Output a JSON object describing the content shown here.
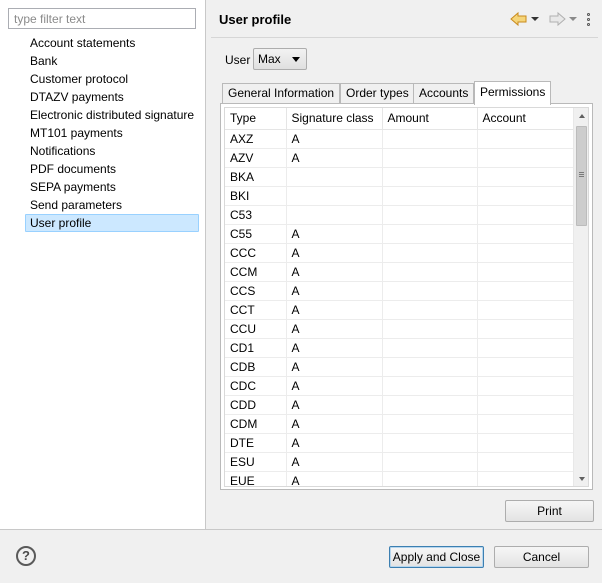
{
  "sidebar": {
    "filter_placeholder": "type filter text",
    "items": [
      {
        "label": "Account statements"
      },
      {
        "label": "Bank"
      },
      {
        "label": "Customer protocol"
      },
      {
        "label": "DTAZV payments"
      },
      {
        "label": "Electronic distributed signature"
      },
      {
        "label": "MT101 payments"
      },
      {
        "label": "Notifications"
      },
      {
        "label": "PDF documents"
      },
      {
        "label": "SEPA payments"
      },
      {
        "label": "Send parameters"
      },
      {
        "label": "User profile",
        "selected": true
      }
    ]
  },
  "header": {
    "title": "User profile",
    "back_icon": "back-arrow-icon",
    "forward_icon": "forward-arrow-icon",
    "menu_icon": "view-menu-icon"
  },
  "user": {
    "label": "User",
    "selected": "Max"
  },
  "tabs": [
    {
      "label": "General Information"
    },
    {
      "label": "Order types"
    },
    {
      "label": "Accounts"
    },
    {
      "label": "Permissions",
      "active": true
    }
  ],
  "table": {
    "columns": [
      "Type",
      "Signature class",
      "Amount",
      "Account"
    ],
    "rows": [
      {
        "type": "AXZ",
        "sig": "A",
        "amount": "",
        "account": ""
      },
      {
        "type": "AZV",
        "sig": "A",
        "amount": "",
        "account": ""
      },
      {
        "type": "BKA",
        "sig": "",
        "amount": "",
        "account": ""
      },
      {
        "type": "BKI",
        "sig": "",
        "amount": "",
        "account": ""
      },
      {
        "type": "C53",
        "sig": "",
        "amount": "",
        "account": ""
      },
      {
        "type": "C55",
        "sig": "A",
        "amount": "",
        "account": ""
      },
      {
        "type": "CCC",
        "sig": "A",
        "amount": "",
        "account": ""
      },
      {
        "type": "CCM",
        "sig": "A",
        "amount": "",
        "account": ""
      },
      {
        "type": "CCS",
        "sig": "A",
        "amount": "",
        "account": ""
      },
      {
        "type": "CCT",
        "sig": "A",
        "amount": "",
        "account": ""
      },
      {
        "type": "CCU",
        "sig": "A",
        "amount": "",
        "account": ""
      },
      {
        "type": "CD1",
        "sig": "A",
        "amount": "",
        "account": ""
      },
      {
        "type": "CDB",
        "sig": "A",
        "amount": "",
        "account": ""
      },
      {
        "type": "CDC",
        "sig": "A",
        "amount": "",
        "account": ""
      },
      {
        "type": "CDD",
        "sig": "A",
        "amount": "",
        "account": ""
      },
      {
        "type": "CDM",
        "sig": "A",
        "amount": "",
        "account": ""
      },
      {
        "type": "DTE",
        "sig": "A",
        "amount": "",
        "account": ""
      },
      {
        "type": "ESU",
        "sig": "A",
        "amount": "",
        "account": ""
      },
      {
        "type": "EUE",
        "sig": "A",
        "amount": "",
        "account": ""
      }
    ]
  },
  "buttons": {
    "print": "Print",
    "apply_close": "Apply and Close",
    "cancel": "Cancel",
    "help": "?"
  },
  "colors": {
    "selection_bg": "#cce8ff",
    "selection_border": "#99d1ff",
    "arrow_back": "#e8a33a",
    "arrow_forward_disabled": "#b8b8b8"
  }
}
